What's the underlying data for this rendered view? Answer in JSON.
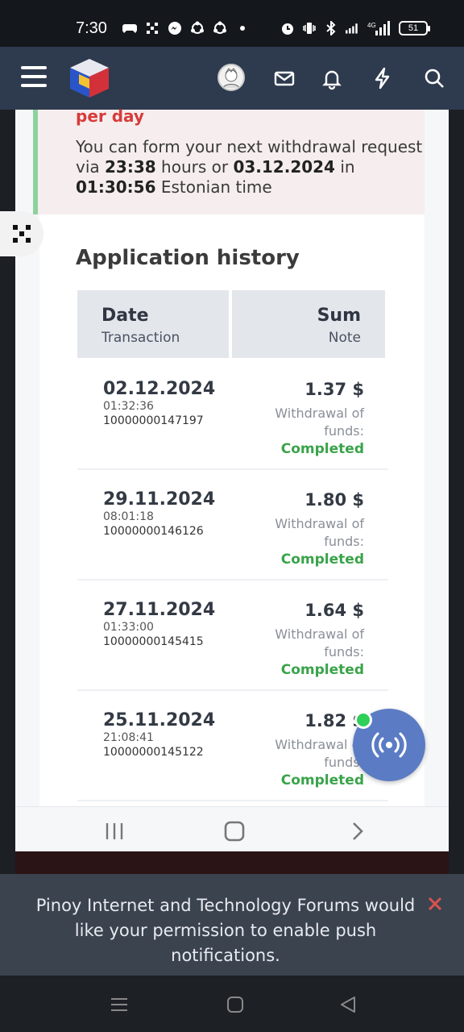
{
  "status_bar": {
    "time": "7:30",
    "battery": "51",
    "network": "4G"
  },
  "header": {
    "icons": [
      "menu-icon",
      "forum-logo",
      "avatar",
      "mail-icon",
      "bell-icon",
      "bolt-icon",
      "search-icon"
    ]
  },
  "notice": {
    "per_day": "per day",
    "text_before": "You can form your next withdrawal request via ",
    "hours": "23:38",
    "text_mid": " hours or ",
    "date": "03.12.2024",
    "text_in": " in ",
    "time": "01:30:56",
    "text_after": " Estonian time"
  },
  "history": {
    "title": "Application history",
    "headers": {
      "date": "Date",
      "transaction": "Transaction",
      "sum": "Sum",
      "note": "Note"
    },
    "rows": [
      {
        "date": "02.12.2024",
        "time": "01:32:36",
        "tx": "10000000147197",
        "sum": "1.37 $",
        "note": "Withdrawal of funds:",
        "status": "Completed"
      },
      {
        "date": "29.11.2024",
        "time": "08:01:18",
        "tx": "10000000146126",
        "sum": "1.80 $",
        "note": "Withdrawal of funds:",
        "status": "Completed"
      },
      {
        "date": "27.11.2024",
        "time": "01:33:00",
        "tx": "10000000145415",
        "sum": "1.64 $",
        "note": "Withdrawal of funds:",
        "status": "Completed"
      },
      {
        "date": "25.11.2024",
        "time": "21:08:41",
        "tx": "10000000145122",
        "sum": "1.82 $",
        "note": "Withdrawal of funds:",
        "status": "Completed"
      }
    ]
  },
  "push_banner": {
    "text": "Pinoy Internet and Technology Forums would like your permission to enable push notifications."
  },
  "colors": {
    "header_bg": "#2e3a4e",
    "completed": "#3aa34a",
    "accent_red": "#d73b3b",
    "float_button": "#5b7cc4"
  }
}
